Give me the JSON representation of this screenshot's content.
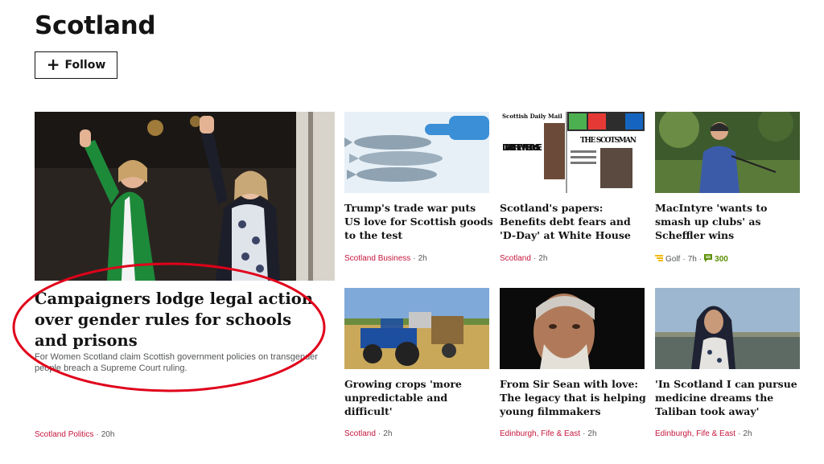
{
  "page": {
    "title": "Scotland"
  },
  "follow": {
    "label": "Follow"
  },
  "lead": {
    "headline": "Campaigners lodge legal action over gender rules for schools and prisons",
    "summary": "For Women Scotland claim Scottish government policies on transgender people breach a Supreme Court ruling.",
    "category": "Scotland Politics",
    "time": "20h"
  },
  "cards": [
    {
      "headline": "Trump's trade war puts US love for Scottish goods to the test",
      "category": "Scotland Business",
      "time": "2h"
    },
    {
      "headline": "Scotland's papers: Benefits debt fears and 'D-Day' at White House",
      "category": "Scotland",
      "time": "2h"
    },
    {
      "headline": "MacIntyre 'wants to smash up clubs' as Scheffler wins",
      "category": "Golf",
      "time": "7h",
      "comments": "300"
    },
    {
      "headline": "Growing crops 'more unpredictable and difficult'",
      "category": "Scotland",
      "time": "2h"
    },
    {
      "headline": "From Sir Sean with love: The legacy that is helping young filmmakers",
      "category": "Edinburgh, Fife & East",
      "time": "2h"
    },
    {
      "headline": "'In Scotland I can pursue medicine dreams the Taliban took away'",
      "category": "Edinburgh, Fife & East",
      "time": "2h"
    }
  ],
  "newspaper": {
    "masthead1": "Scottish Daily Mail",
    "headline1": "D-DAY AT THE WHITE HOUSE",
    "masthead2": "THE SCOTSMAN"
  },
  "colors": {
    "accent": "#c6163c",
    "annotation": "#e0001a",
    "comment_green": "#5a8f00",
    "golf_yellow": "#f4b800"
  }
}
